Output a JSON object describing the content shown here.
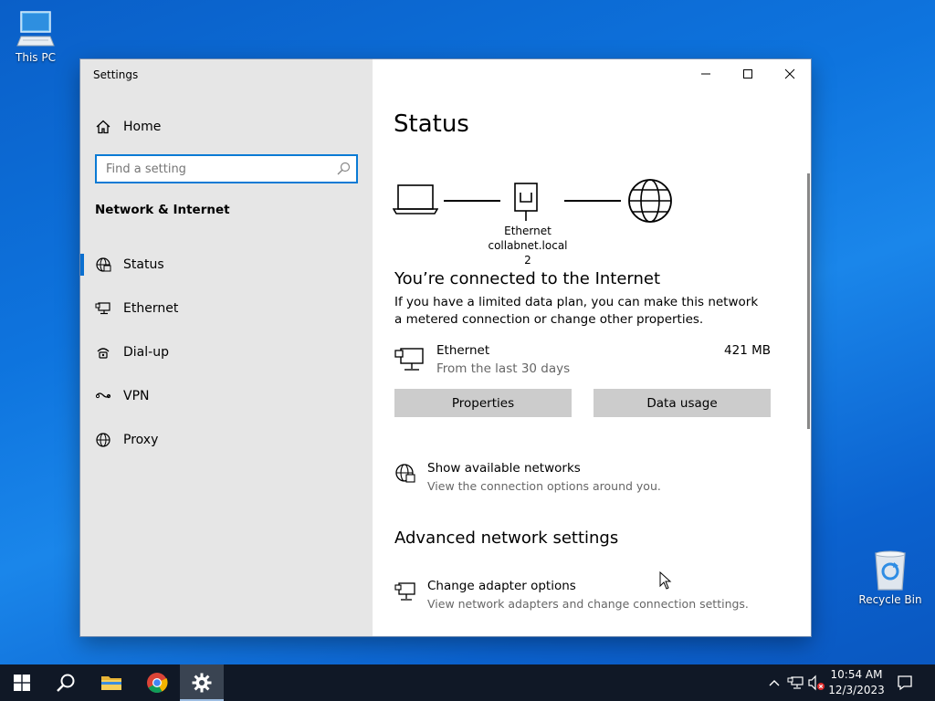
{
  "desktop": {
    "this_pc_label": "This PC",
    "recycle_bin_label": "Recycle Bin"
  },
  "window": {
    "title": "Settings",
    "minimize_icon": "minimize-icon",
    "maximize_icon": "maximize-icon",
    "close_icon": "close-icon"
  },
  "sidebar": {
    "home_label": "Home",
    "search_placeholder": "Find a setting",
    "section_title": "Network & Internet",
    "items": [
      {
        "label": "Status",
        "icon": "status-globe-icon",
        "active": true
      },
      {
        "label": "Ethernet",
        "icon": "ethernet-icon",
        "active": false
      },
      {
        "label": "Dial-up",
        "icon": "dialup-icon",
        "active": false
      },
      {
        "label": "VPN",
        "icon": "vpn-icon",
        "active": false
      },
      {
        "label": "Proxy",
        "icon": "proxy-globe-icon",
        "active": false
      }
    ]
  },
  "main": {
    "title": "Status",
    "diagram": {
      "adapter_name": "Ethernet",
      "network_name": "collabnet.local 2"
    },
    "connected_title": "You’re connected to the Internet",
    "connected_desc": "If you have a limited data plan, you can make this network a metered connection or change other properties.",
    "ethernet": {
      "name": "Ethernet",
      "subtitle": "From the last 30 days",
      "usage": "421 MB"
    },
    "buttons": {
      "properties": "Properties",
      "data_usage": "Data usage"
    },
    "show_networks": {
      "title": "Show available networks",
      "subtitle": "View the connection options around you."
    },
    "advanced_title": "Advanced network settings",
    "change_adapter": {
      "title": "Change adapter options",
      "subtitle": "View network adapters and change connection settings."
    }
  },
  "taskbar": {
    "time": "10:54 AM",
    "date": "12/3/2023"
  },
  "colors": {
    "accent": "#0a6fd0",
    "sidebar_bg": "#e6e6e6",
    "button_bg": "#cccccc",
    "taskbar_bg": "#101826"
  }
}
